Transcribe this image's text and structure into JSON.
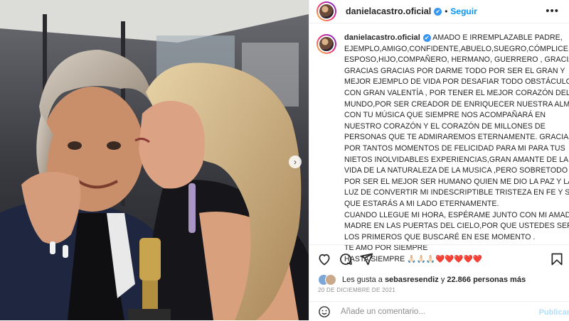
{
  "header": {
    "username": "danielacastro.oficial",
    "separator": "•",
    "follow_label": "Seguir",
    "more_label": "•••"
  },
  "caption": {
    "username": "danielacastro.oficial",
    "lines": [
      "AMADO E IRREMPLAZABLE PADRE,",
      "EJEMPLO,AMIGO,CONFIDENTE,ABUELO,SUEGRO,CÓMPLICE,",
      "ESPOSO,HIJO,COMPAÑERO, HERMANO, GUERRERO , GRACIAS",
      "GRACIAS GRACIAS POR DARME TODO POR SER EL GRAN Y",
      "MEJOR EJEMPLO DE VIDA POR DESAFIAR TODO OBSTÁCULO",
      "CON GRAN VALENTÍA , POR TENER EL MEJOR CORAZÓN DEL",
      "MUNDO,POR SER CREADOR DE ENRIQUECER NUESTRA ALMA",
      "CON TU MÚSICA QUE SIEMPRE NOS ACOMPAÑARÁ EN",
      "NUESTRO CORAZÓN Y EL CORAZÓN DE MILLONES DE",
      "PERSONAS QUE TE ADMIRAREMOS ETERNAMENTE. GRACIAS",
      "POR TANTOS MOMENTOS DE FELICIDAD PARA MI PARA TUS",
      "NIETOS INOLVIDABLES EXPERIENCIAS,GRAN AMANTE DE LA",
      "VIDA DE LA NATURALEZA DE LA MUSICA ,PERO SOBRETODO",
      "POR SER EL MEJOR SER HUMANO QUIEN ME DIO LA PAZ Y LA",
      "LUZ DE CONVERTIR MI INDESCRIPTIBLE TRISTEZA EN FE Y SE",
      "QUE ESTARÁS A MI LADO ETERNAMENTE.",
      "CUANDO LLEGUE MI HORA, ESPÉRAME JUNTO CON MI AMADA",
      "MADRE EN LAS PUERTAS DEL CIELO,POR QUE USTEDES SERÁN",
      "LOS PRIMEROS QUE BUSCARÉ EN ESE MOMENTO .",
      "TE AMO POR SIEMPRE",
      "HASTA SIEMPRE 🙏🏻🙏🏻🙏🏻❤️❤️❤️❤️❤️"
    ]
  },
  "likes": {
    "prefix": "Les gusta a",
    "user": "sebasresendiz",
    "connector": "y",
    "count": "22.866 personas más"
  },
  "date": "20 DE DICIEMBRE DE 2021",
  "comment": {
    "placeholder": "Añade un comentario...",
    "publish_label": "Publicar"
  },
  "icons": {
    "like": "heart-icon",
    "comment": "comment-icon",
    "share": "share-icon",
    "save": "bookmark-icon",
    "emoji": "emoji-icon",
    "next": "chevron-right-icon"
  },
  "colors": {
    "accent": "#0095f6",
    "verified": "#3897f0",
    "muted": "#8e8e8e",
    "publish_disabled": "#b2dffc"
  }
}
